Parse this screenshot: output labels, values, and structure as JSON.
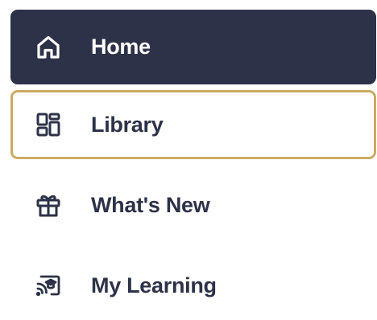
{
  "nav": {
    "items": [
      {
        "label": "Home",
        "icon": "home-icon",
        "state": "active"
      },
      {
        "label": "Library",
        "icon": "library-icon",
        "state": "focused"
      },
      {
        "label": "What's New",
        "icon": "gift-icon",
        "state": "default"
      },
      {
        "label": "My Learning",
        "icon": "my-learning-icon",
        "state": "default"
      }
    ]
  },
  "colors": {
    "active_bg": "#2e3248",
    "active_text": "#ffffff",
    "text": "#2e3248",
    "focus_border": "#c9ab63",
    "background": "#ffffff"
  }
}
